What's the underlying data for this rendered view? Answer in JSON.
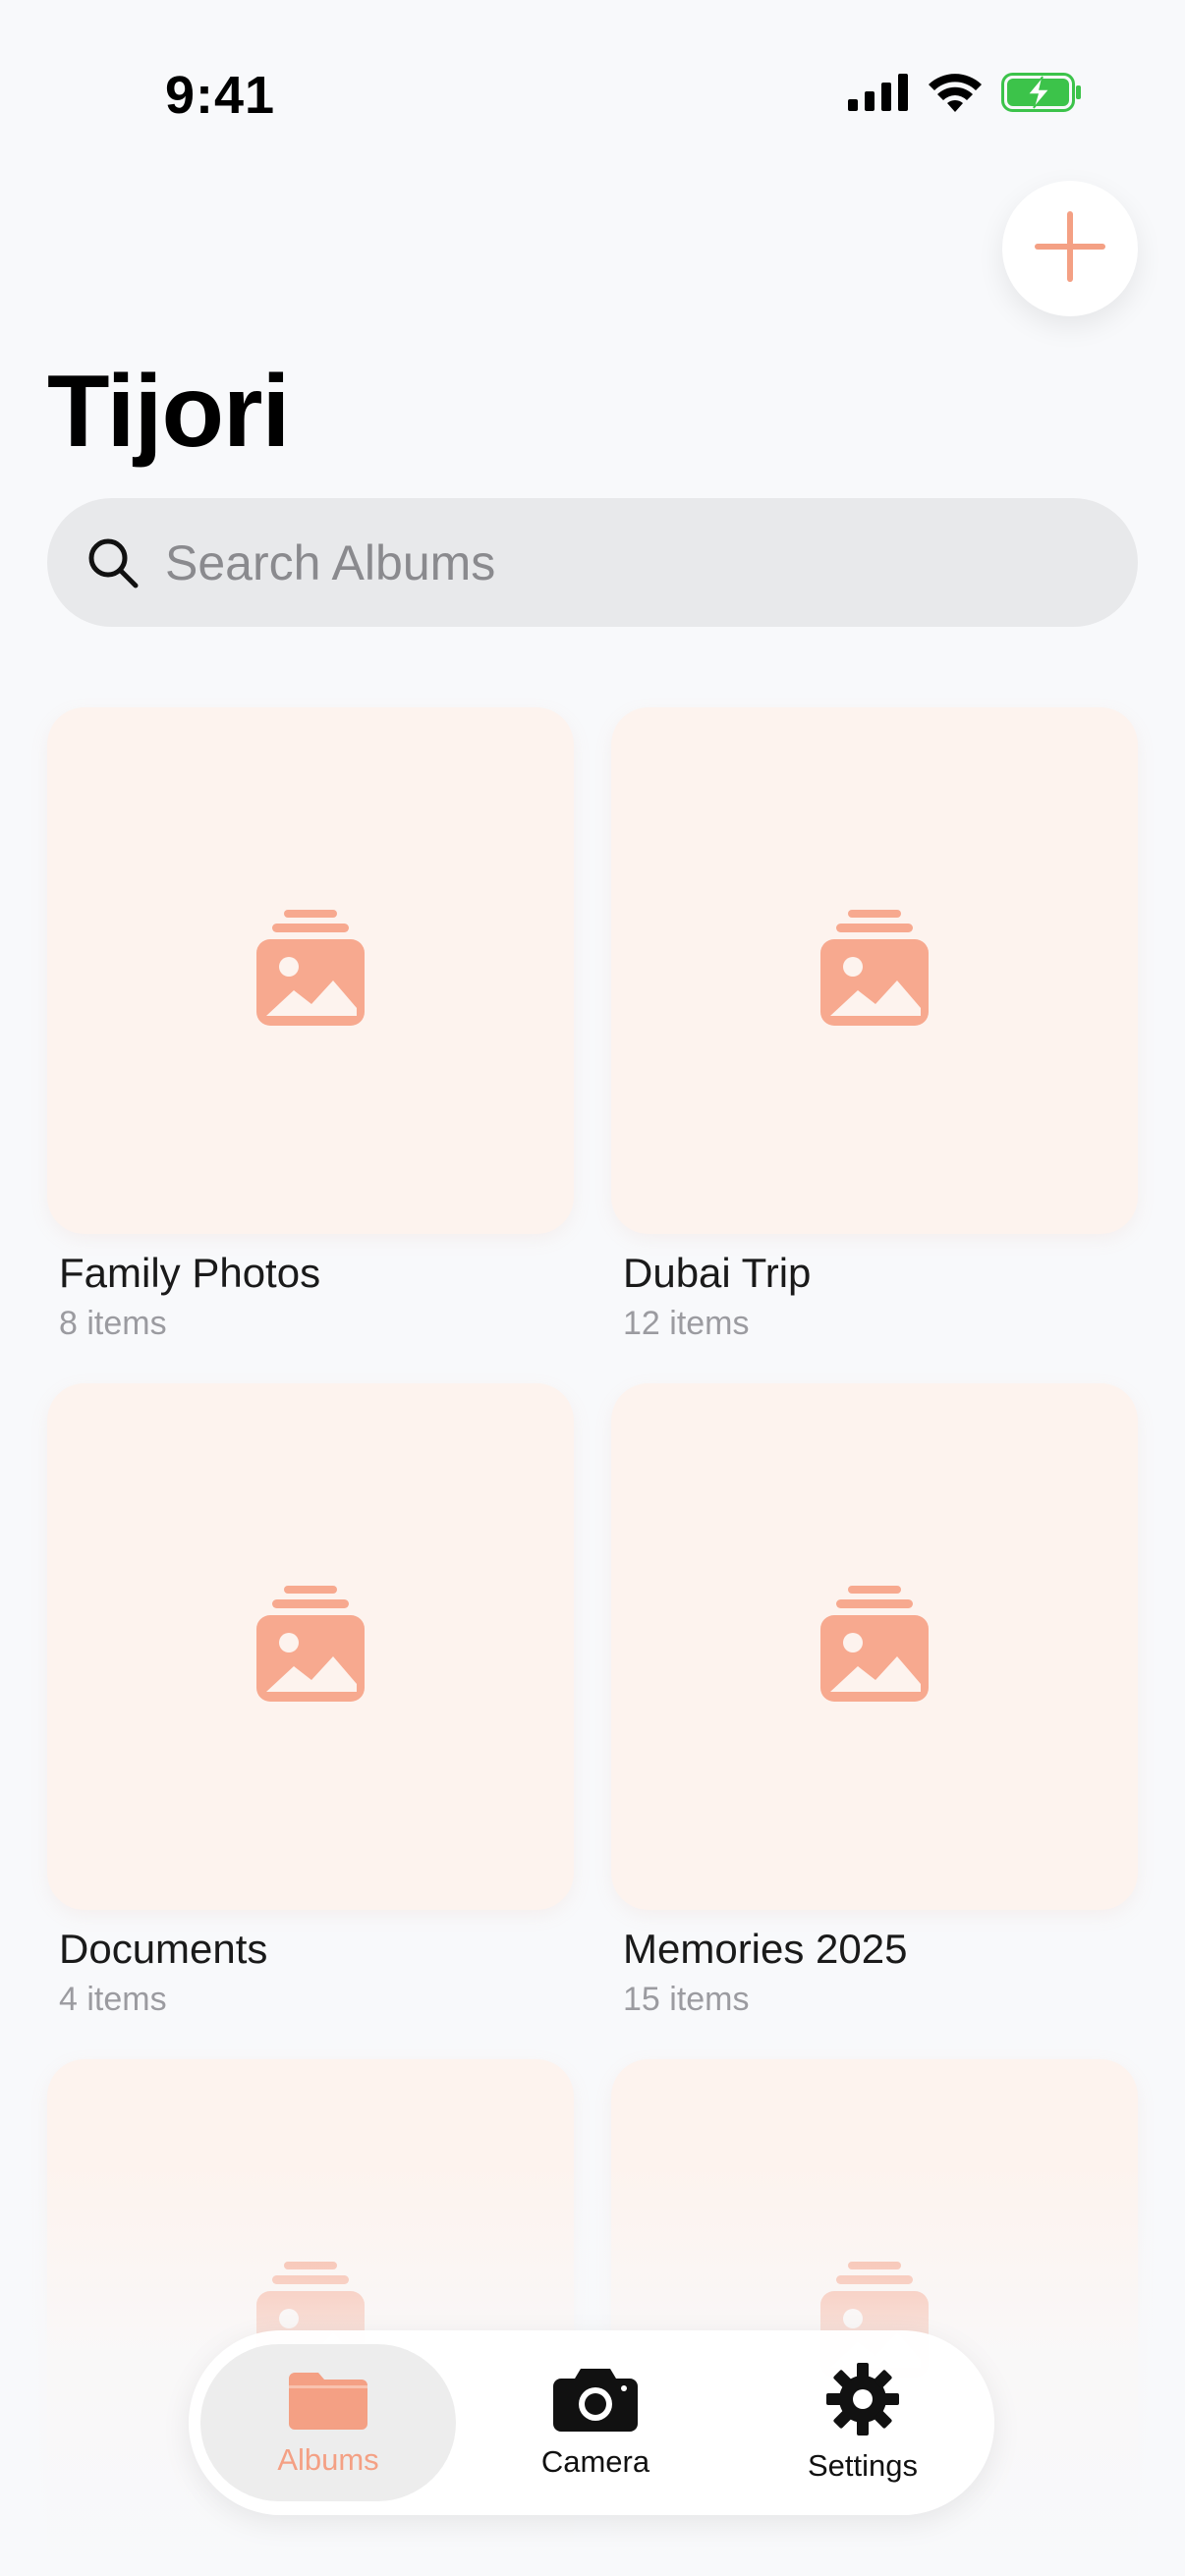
{
  "status": {
    "time": "9:41"
  },
  "header": {
    "title": "Tijori",
    "add_icon": "plus-icon"
  },
  "search": {
    "placeholder": "Search Albums",
    "value": "",
    "icon": "search-icon"
  },
  "albums": [
    {
      "name": "Family Photos",
      "count": "8 items"
    },
    {
      "name": "Dubai Trip",
      "count": "12 items"
    },
    {
      "name": "Documents",
      "count": "4 items"
    },
    {
      "name": "Memories 2025",
      "count": "15 items"
    },
    {
      "name": "",
      "count": ""
    },
    {
      "name": "",
      "count": ""
    }
  ],
  "tabbar": {
    "tabs": [
      {
        "label": "Albums",
        "icon": "folder-icon",
        "active": true
      },
      {
        "label": "Camera",
        "icon": "camera-icon",
        "active": false
      },
      {
        "label": "Settings",
        "icon": "gear-icon",
        "active": false
      }
    ]
  },
  "colors": {
    "accent": "#F4A084",
    "thumb_bg": "#FDF3EE",
    "background": "#F8F9FB",
    "battery": "#3CC34A"
  }
}
